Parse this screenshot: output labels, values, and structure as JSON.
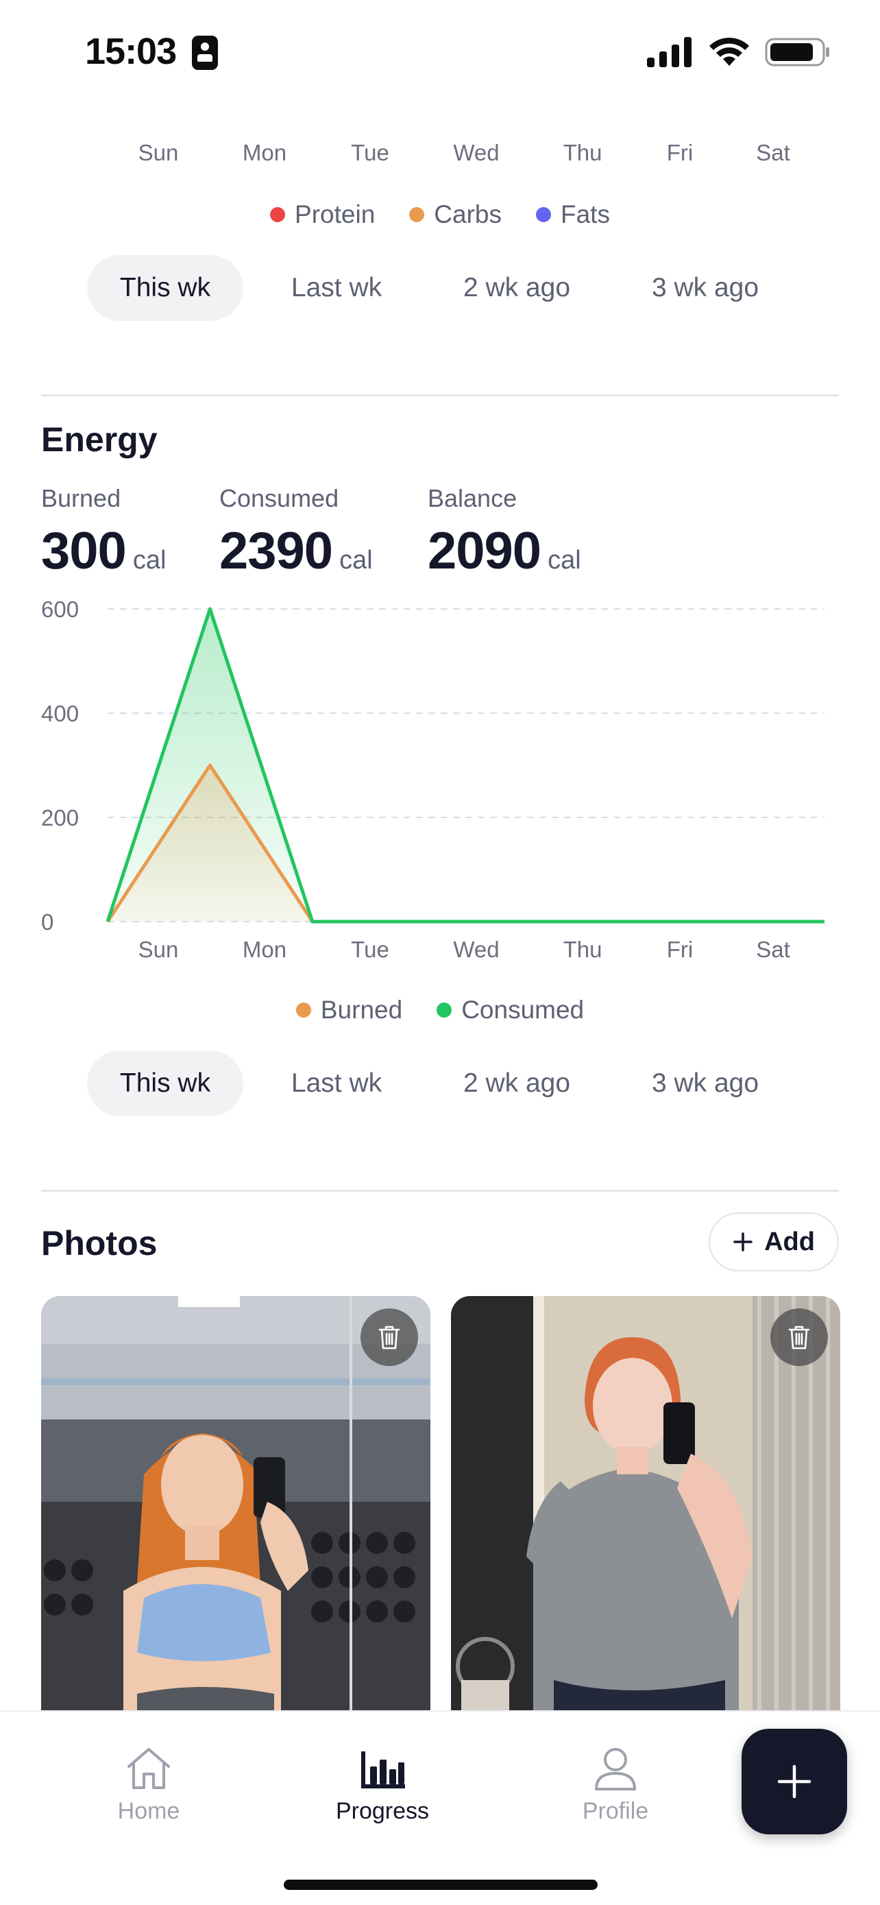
{
  "status_bar": {
    "time": "15:03"
  },
  "macros_chart": {
    "days": [
      "Sun",
      "Mon",
      "Tue",
      "Wed",
      "Thu",
      "Fri",
      "Sat"
    ],
    "legend": [
      {
        "label": "Protein",
        "color": "#ef4444"
      },
      {
        "label": "Carbs",
        "color": "#e99a4f"
      },
      {
        "label": "Fats",
        "color": "#6366f1"
      }
    ],
    "week_tabs": [
      "This wk",
      "Last wk",
      "2 wk ago",
      "3 wk ago"
    ],
    "active_tab": 0
  },
  "energy": {
    "title": "Energy",
    "stats": [
      {
        "label": "Burned",
        "value": "300",
        "unit": "cal"
      },
      {
        "label": "Consumed",
        "value": "2390",
        "unit": "cal"
      },
      {
        "label": "Balance",
        "value": "2090",
        "unit": "cal"
      }
    ],
    "week_tabs": [
      "This wk",
      "Last wk",
      "2 wk ago",
      "3 wk ago"
    ],
    "active_tab": 0
  },
  "chart_data": {
    "type": "area",
    "x": [
      0,
      1,
      2,
      3,
      4,
      5,
      6,
      7
    ],
    "categories": [
      "Sun",
      "Mon",
      "Tue",
      "Wed",
      "Thu",
      "Fri",
      "Sat"
    ],
    "yticks": [
      "600",
      "400",
      "200",
      "0"
    ],
    "ylim": [
      0,
      600
    ],
    "grid": true,
    "legend_position": "bottom",
    "series": [
      {
        "name": "Burned",
        "color": "#e99a4f",
        "values": [
          0,
          300,
          0,
          0,
          0,
          0,
          0,
          0
        ]
      },
      {
        "name": "Consumed",
        "color": "#22c55e",
        "values": [
          0,
          600,
          0,
          0,
          0,
          0,
          0,
          0
        ]
      }
    ]
  },
  "photos": {
    "title": "Photos",
    "add_label": "Add"
  },
  "tabbar": {
    "tabs": [
      {
        "label": "Home",
        "icon": "home-icon"
      },
      {
        "label": "Progress",
        "icon": "bar-chart-icon"
      },
      {
        "label": "Profile",
        "icon": "person-icon"
      }
    ],
    "active": 1
  }
}
